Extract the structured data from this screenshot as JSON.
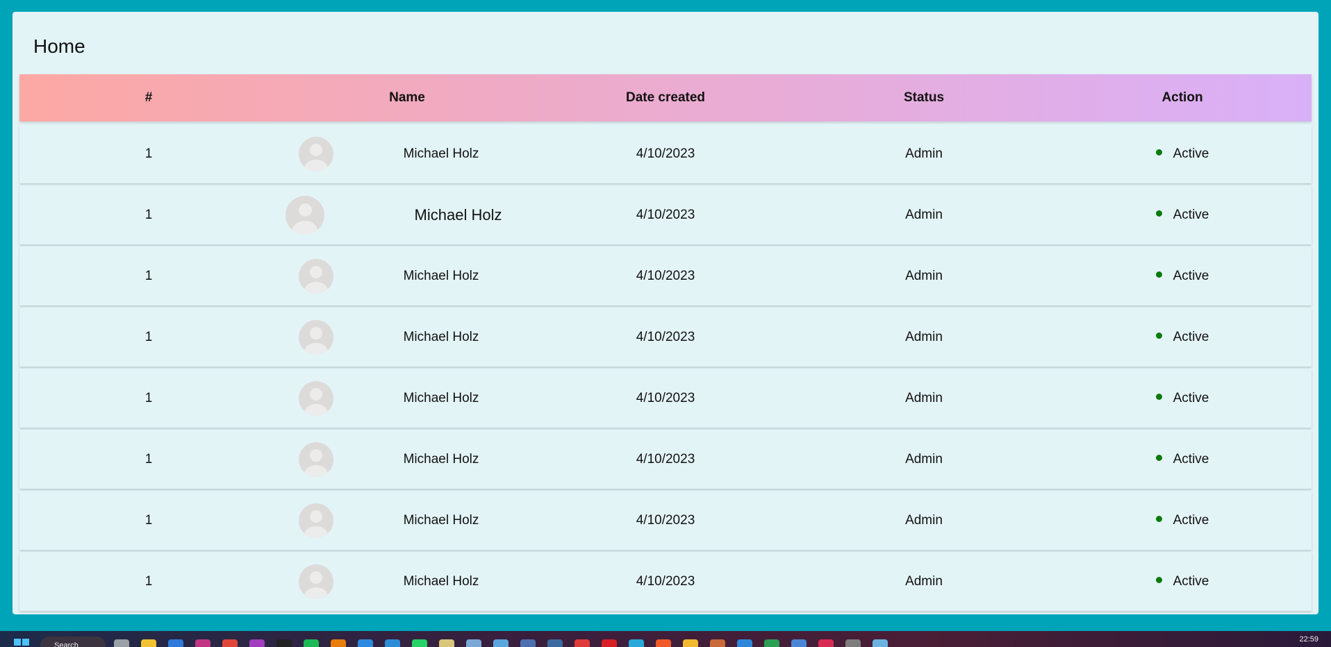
{
  "page": {
    "title": "Home"
  },
  "table": {
    "headers": [
      "#",
      "Name",
      "Date created",
      "Status",
      "Action"
    ],
    "rows": [
      {
        "index": "1",
        "name": "Michael Holz",
        "date": "4/10/2023",
        "status": "Admin",
        "action": "Active"
      },
      {
        "index": "1",
        "name": "Michael Holz",
        "date": "4/10/2023",
        "status": "Admin",
        "action": "Active"
      },
      {
        "index": "1",
        "name": "Michael Holz",
        "date": "4/10/2023",
        "status": "Admin",
        "action": "Active"
      },
      {
        "index": "1",
        "name": "Michael Holz",
        "date": "4/10/2023",
        "status": "Admin",
        "action": "Active"
      },
      {
        "index": "1",
        "name": "Michael Holz",
        "date": "4/10/2023",
        "status": "Admin",
        "action": "Active"
      },
      {
        "index": "1",
        "name": "Michael Holz",
        "date": "4/10/2023",
        "status": "Admin",
        "action": "Active"
      },
      {
        "index": "1",
        "name": "Michael Holz",
        "date": "4/10/2023",
        "status": "Admin",
        "action": "Active"
      },
      {
        "index": "1",
        "name": "Michael Holz",
        "date": "4/10/2023",
        "status": "Admin",
        "action": "Active"
      }
    ]
  },
  "colors": {
    "page_background": "#00a4b8",
    "card_background": "#e3f4f7",
    "header_gradient_start": "#fca8a4",
    "header_gradient_end": "#d9b0f8",
    "active_dot": "#0a7a0a"
  },
  "taskbar": {
    "search_label": "Search",
    "clock": "22:59",
    "icons": [
      "windows-start-icon",
      "task-view-icon",
      "file-explorer-icon",
      "store-icon",
      "instagram-icon",
      "chrome-icon",
      "intellij-icon",
      "terminal-icon",
      "spotify-icon",
      "blender-icon",
      "vscode-icon",
      "edge-icon",
      "whatsapp-icon",
      "app-icon",
      "app-icon",
      "notepad-icon",
      "app-icon",
      "app-icon",
      "app-icon",
      "opera-icon",
      "app-icon",
      "app-icon",
      "app-icon",
      "app-icon",
      "app-icon",
      "app-icon",
      "app-icon",
      "app-icon",
      "app-icon",
      "globe-icon"
    ]
  }
}
